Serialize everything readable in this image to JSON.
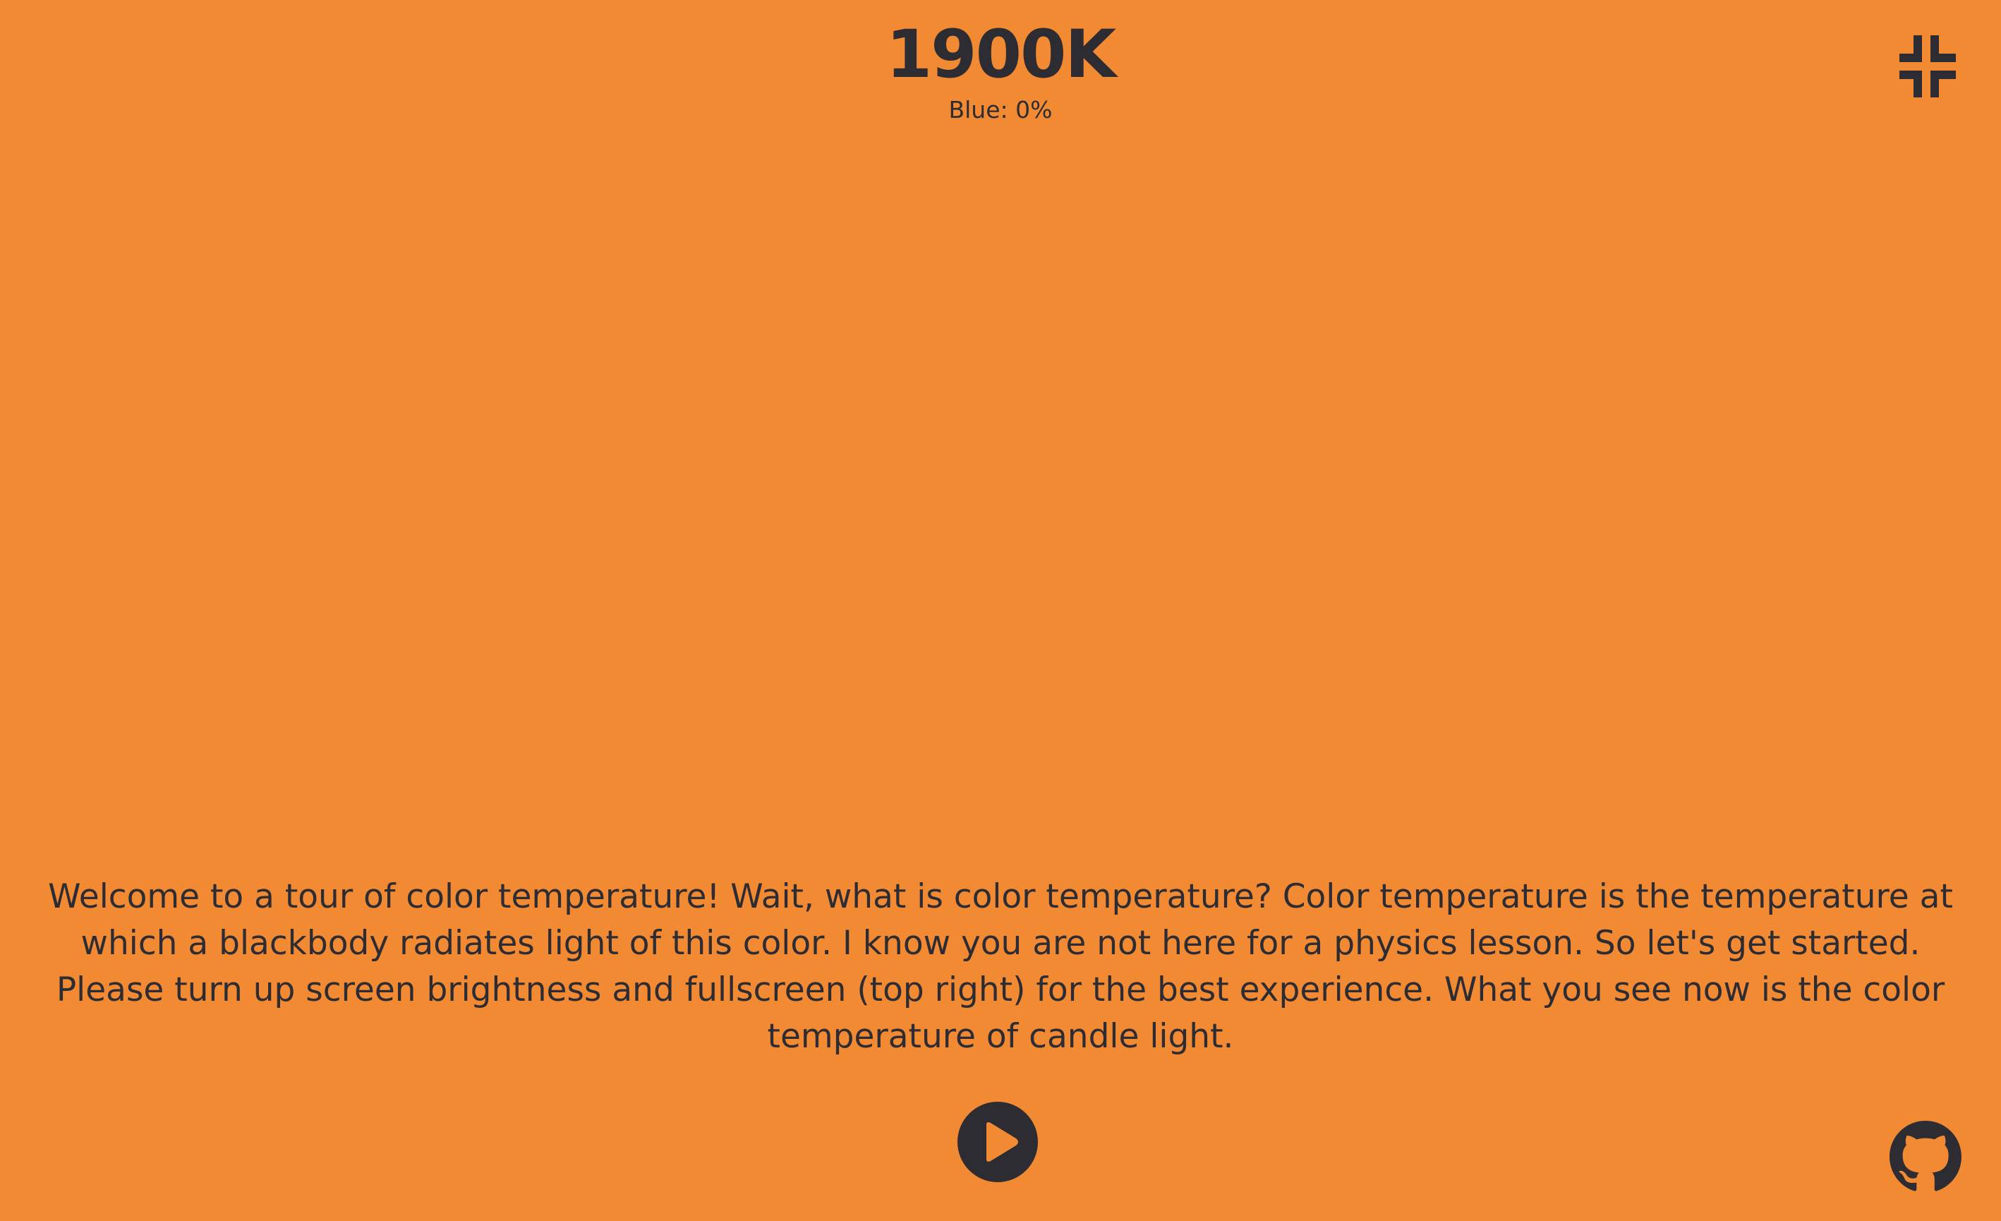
{
  "header": {
    "temperature": "1900K",
    "blue_level": "Blue: 0%"
  },
  "message": {
    "text": "Welcome to a tour of color temperature! Wait, what is color temperature? Color temperature is the temperature at which a blackbody radiates light of this color. I know you are not here for a physics lesson. So let's get started. Please turn up screen brightness and fullscreen (top right) for the best experience. What you see now is the color temperature of candle light."
  },
  "controls": {
    "fullscreen_icon": "exit-fullscreen-icon",
    "play_icon": "play-icon",
    "github_icon": "github-icon"
  },
  "colors": {
    "background": "#F28A34",
    "foreground": "#2E2C33"
  }
}
